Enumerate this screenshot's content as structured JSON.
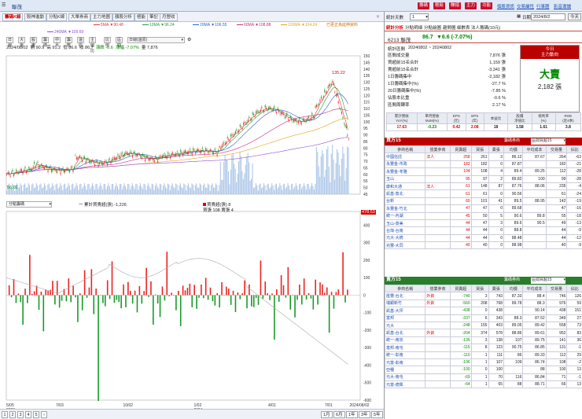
{
  "topbar": {
    "title": "聯茂",
    "buttons": [
      "籌碼",
      "輕鬆",
      "賺錢",
      "主力",
      "功能"
    ],
    "links": [
      "個股資訊",
      "交易屬性",
      "行事曆",
      "影音導讀"
    ]
  },
  "tabs": [
    "籌碼K線",
    "股神進動",
    "分點K線",
    "大單券商",
    "主力地圖",
    "額股分析",
    "極能",
    "筆記",
    "月營收"
  ],
  "ma_legend": [
    {
      "label": "5MA ▼90.48",
      "color": "#e33"
    },
    {
      "label": "10MA ▼96.24",
      "color": "#2a9d3a"
    },
    {
      "label": "20MA ▼106.55",
      "color": "#2b5fd9"
    },
    {
      "label": "60MA ▼108.88",
      "color": "#d0287d"
    },
    {
      "label": "120MA ▼104.24",
      "color": "#e8a020"
    },
    {
      "label": "240MA ▼109.69",
      "color": "#8a4fd8"
    }
  ],
  "notice": "已更正為延伸資料",
  "toolbar": [
    "日線",
    "大單",
    "股東",
    "籌碼",
    "中月",
    "籌數",
    "還原",
    "主圖比",
    "比例",
    "區間",
    "日線(還原)"
  ],
  "info": {
    "date": "2024/08/02",
    "open": "開 90.9",
    "high": "高 91.2",
    "low": "低 86.6",
    "close": "收 86.7",
    "change_label": "漲跌 -6.6",
    "pct_label": "漲幅 -7.07%",
    "volume_label": "量 7,876"
  },
  "peak_label": "135.22",
  "low_label": "56.02",
  "price_axis": [
    "150",
    "145",
    "140",
    "135",
    "130",
    "125",
    "120",
    "115",
    "110",
    "105",
    "100",
    "95",
    "90",
    "85",
    "80",
    "75",
    "70",
    "65",
    "60",
    "55",
    "50",
    "45"
  ],
  "lower_header": {
    "select": "分點籌碼",
    "legend1": "一 累計買賣超(張) -1,226",
    "legend2": "買賣超(張) 8",
    "legend3": "買張 108 賣張 4",
    "current_value": "478.53"
  },
  "lower_axis": [
    "400",
    "300",
    "200",
    "100",
    "0",
    "-100",
    "-200",
    "-300",
    "-400",
    "-500",
    "-600"
  ],
  "date_axis": [
    {
      "label": "5/05\n2023"
    },
    {
      "label": "7/03"
    },
    {
      "label": "10/02"
    },
    {
      "label": "1/02\n2024"
    },
    {
      "label": "4/01"
    },
    {
      "label": "7/01"
    },
    {
      "label": "2024/08/02"
    }
  ],
  "pager": {
    "pages": [
      "1",
      "2",
      "3",
      "4",
      "5"
    ],
    "ranges": [
      "1月",
      "6月",
      "1年",
      "3年",
      "5年"
    ]
  },
  "right": {
    "stat_days_label": "統計天數",
    "stat_days_value": "1",
    "date_label": "日期",
    "date_value": "2024/8/2",
    "today_btn": "今天",
    "subtabs": [
      "統計分析",
      "分點明細",
      "分點繪圖",
      "趨勢圖",
      "細數表",
      "法人籌碼(10元)"
    ],
    "stock": "6213 聯茂",
    "price": "86.7",
    "change": "▼6.6 (-7.07%)",
    "stat_period_label": "統計區間",
    "stat_period": "20240802 ~ 20240802",
    "stats": [
      {
        "label": "區間成交量",
        "value": "7,876 張",
        "cls": ""
      },
      {
        "label": "買超前15名合計",
        "value": "1,159 張",
        "cls": ""
      },
      {
        "label": "賣超前15名合計",
        "value": "-3,341 張",
        "cls": ""
      },
      {
        "label": "1日籌碼集中",
        "value": "-2,182 張",
        "cls": ""
      },
      {
        "label": "1日籌碼集中(%)",
        "value": "-27.7 %",
        "cls": ""
      },
      {
        "label": "20日籌碼集中(%)",
        "value": "-7.85 %",
        "cls": ""
      },
      {
        "label": "佔股本比重",
        "value": "-0.6 %",
        "cls": ""
      },
      {
        "label": "區間周轉率",
        "value": "2.17 %",
        "cls": ""
      }
    ],
    "today_box": {
      "title": "今日",
      "subtitle": "主力動向",
      "main": "大賣",
      "value": "2,182 張"
    },
    "metrics_header": [
      "累計營收\nYoY(%)",
      "單月營收\nMoM(%)",
      "EPS\n(元)",
      "EPS\n(年)",
      "本益比",
      "股價\n淨值比",
      "殖利率\n(%)",
      "ROE\n(近4季)"
    ],
    "metrics_values": [
      "17.63",
      "-0.23",
      "0.42",
      "2.08",
      "18",
      "1.58",
      "1.61",
      "3.8"
    ],
    "buy_title": "買方15",
    "sell_title": "賣方15",
    "filter_btn": "籌碼券商",
    "filter_select": "區間買超15",
    "table_header": [
      "參商名稱",
      "營業參商",
      "買賣超",
      "買張",
      "賣張",
      "均價",
      "平均成本",
      "交易量",
      "佔比"
    ],
    "buy_rows": [
      [
        "中國信託",
        "法人",
        "258",
        "261",
        "3",
        "86.12",
        "87.67",
        "264",
        "-63"
      ],
      [
        "永豐金-市政",
        "",
        "182",
        "182",
        "0",
        "87.87",
        "",
        "182",
        "-21"
      ],
      [
        "永豐金-苓雅",
        "",
        "104",
        "108",
        "4",
        "89.4",
        "89.25",
        "112",
        "-28"
      ],
      [
        "玉山",
        "",
        "95",
        "97",
        "2",
        "89.82",
        "100",
        "99",
        "-28"
      ],
      [
        "康和大通",
        "法人",
        "61",
        "148",
        "87",
        "87.76",
        "88.06",
        "235",
        "-4"
      ],
      [
        "凱基-敦北",
        "",
        "61",
        "61",
        "0",
        "90.56",
        "",
        "61",
        "-24"
      ],
      [
        "台新",
        "",
        "60",
        "101",
        "41",
        "89.5",
        "88.95",
        "142",
        "-19"
      ],
      [
        "永豐金-竹北",
        "",
        "47",
        "47",
        "0",
        "89.68",
        "",
        "47",
        "-16"
      ],
      [
        "統一-內湖",
        "",
        "45",
        "50",
        "5",
        "90.6",
        "89.8",
        "55",
        "-18"
      ],
      [
        "玉山-景美",
        "",
        "44",
        "47",
        "3",
        "89.6",
        "90.5",
        "49",
        "-13"
      ],
      [
        "台灣-台南",
        "",
        "44",
        "44",
        "0",
        "88.8",
        "",
        "44",
        "-9"
      ],
      [
        "元大-大統",
        "",
        "44",
        "44",
        "0",
        "88.48",
        "",
        "44",
        "-12"
      ],
      [
        "兆豐-大同",
        "",
        "40",
        "40",
        "0",
        "88.98",
        "",
        "40",
        "-9"
      ]
    ],
    "sell_rows": [
      [
        "匯豐-台北",
        "外資",
        "-740",
        "3",
        "743",
        "87.33",
        "88.4",
        "746",
        "126"
      ],
      [
        "瑞銀新竹",
        "外資",
        "-560",
        "208",
        "768",
        "89.78",
        "88.3",
        "976",
        "59"
      ],
      [
        "凱基-大坪",
        "",
        "-438",
        "0",
        "438",
        "",
        "90.14",
        "438",
        "151"
      ],
      [
        "富邦",
        "",
        "-337",
        "6",
        "343",
        "88.3",
        "87.52",
        "349",
        "27"
      ],
      [
        "元大",
        "",
        "-248",
        "155",
        "403",
        "89.05",
        "89.42",
        "558",
        "73"
      ],
      [
        "凱基-台北",
        "外資",
        "-204",
        "374",
        "578",
        "88.86",
        "89.61",
        "952",
        "83"
      ],
      [
        "統一-南京",
        "",
        "-135",
        "3",
        "138",
        "107",
        "89.75",
        "141",
        "36"
      ],
      [
        "富邦-南屯",
        "",
        "-115",
        "8",
        "123",
        "90.75",
        "86.85",
        "131",
        "-1"
      ],
      [
        "統一-彰南",
        "",
        "-110",
        "1",
        "111",
        "86",
        "89.33",
        "112",
        "29"
      ],
      [
        "元富-彰南",
        "",
        "-106",
        "1",
        "107",
        "109",
        "86.74",
        "108",
        "-2"
      ],
      [
        "亞種",
        "",
        "-100",
        "0",
        "100",
        "",
        "88",
        "100",
        "13"
      ],
      [
        "元大-南屯",
        "",
        "-69",
        "1",
        "70",
        "116",
        "86.84",
        "71",
        "-1"
      ],
      [
        "元富-德興",
        "",
        "-64",
        "1",
        "65",
        "88",
        "88.71",
        "66",
        "13"
      ]
    ]
  },
  "chart_data": {
    "type": "candlestick+bar",
    "price_axis_range": [
      45,
      150
    ],
    "peak": 135.22,
    "low": 56.02,
    "last_close": 86.7,
    "lower_axis_range": [
      -600,
      478.53
    ],
    "cumulative_net": -1226,
    "last_net": 8
  }
}
